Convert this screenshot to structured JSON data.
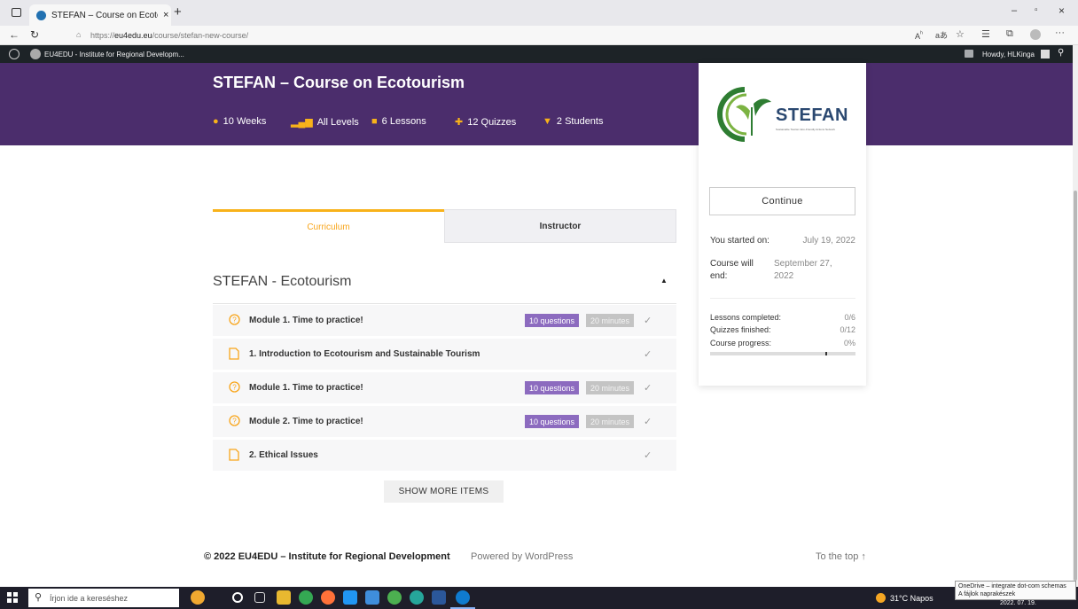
{
  "browser": {
    "tab_title": "STEFAN – Course on Ecotourism",
    "url_prefix": "https://",
    "url_domain": "eu4edu.eu",
    "url_path": "/course/stefan-new-course/"
  },
  "admin_bar": {
    "site_name": "EU4EDU - Institute for Regional Developm...",
    "greeting": "Howdy, HLKinga"
  },
  "course": {
    "title": "STEFAN – Course on Ecotourism",
    "meta": {
      "duration": "10 Weeks",
      "level": "All Levels",
      "lessons": "6 Lessons",
      "quizzes": "12 Quizzes",
      "students": "2 Students"
    }
  },
  "sidebar": {
    "logo_text": "STEFAN",
    "logo_tagline": "Sustainable Tourism Eco-Friendly Actions Network",
    "continue_label": "Continue",
    "started_label": "You started on:",
    "started_value": "July 19, 2022",
    "end_label_1": "Course will",
    "end_label_2": "end:",
    "end_value_1": "September 27,",
    "end_value_2": "2022",
    "lessons_label": "Lessons completed:",
    "lessons_value": "0/6",
    "quizzes_label": "Quizzes finished:",
    "quizzes_value": "0/12",
    "progress_label": "Course progress:",
    "progress_value": "0%",
    "progress_fraction": 0
  },
  "tabs": {
    "curriculum": "Curriculum",
    "instructor": "Instructor"
  },
  "section": {
    "title": "STEFAN - Ecotourism"
  },
  "items": [
    {
      "type": "quiz",
      "title": "Module 1. Time to practice!",
      "questions": "10 questions",
      "duration": "20 minutes"
    },
    {
      "type": "lesson",
      "title": "1. Introduction to Ecotourism and Sustainable Tourism"
    },
    {
      "type": "quiz",
      "title": "Module 1. Time to practice!",
      "questions": "10 questions",
      "duration": "20 minutes"
    },
    {
      "type": "quiz",
      "title": "Module 2. Time to practice!",
      "questions": "10 questions",
      "duration": "20 minutes"
    },
    {
      "type": "lesson",
      "title": "2. Ethical Issues"
    }
  ],
  "show_more": "SHOW MORE ITEMS",
  "footer": {
    "copyright": "© 2022 EU4EDU – Institute for Regional Development",
    "powered": "Powered by WordPress",
    "to_top": "To the top ↑"
  },
  "taskbar": {
    "search_placeholder": "Írjon ide a kereséshez",
    "weather": "31°C Napos",
    "date": "2022. 07. 19."
  },
  "notification": {
    "line1": "OneDrive – integrate dot-com schemas",
    "line2": "A fájlok naprakészek"
  },
  "colors": {
    "hero_bg": "#4b2d6c",
    "accent": "#f8b21a",
    "quiz_badge": "#8c6bbf"
  }
}
